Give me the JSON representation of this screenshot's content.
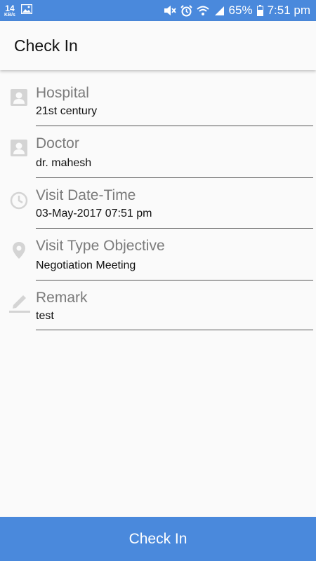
{
  "status_bar": {
    "net_speed": "14",
    "net_unit": "KB/s",
    "battery": "65%",
    "time": "7:51 pm"
  },
  "toolbar": {
    "title": "Check In"
  },
  "fields": [
    {
      "label": "Hospital",
      "value": "21st century",
      "icon": "hospital-icon"
    },
    {
      "label": "Doctor",
      "value": "dr. mahesh",
      "icon": "doctor-icon"
    },
    {
      "label": "Visit Date-Time",
      "value": "03-May-2017 07:51 pm",
      "icon": "clock-icon"
    },
    {
      "label": "Visit Type Objective",
      "value": "Negotiation Meeting",
      "icon": "location-pin-icon"
    },
    {
      "label": "Remark",
      "value": "test",
      "icon": "pencil-icon"
    }
  ],
  "submit": {
    "label": "Check In"
  },
  "colors": {
    "accent": "#4a89dc",
    "icon_gray": "#d4d4d4",
    "label_gray": "#7b7b7b"
  }
}
